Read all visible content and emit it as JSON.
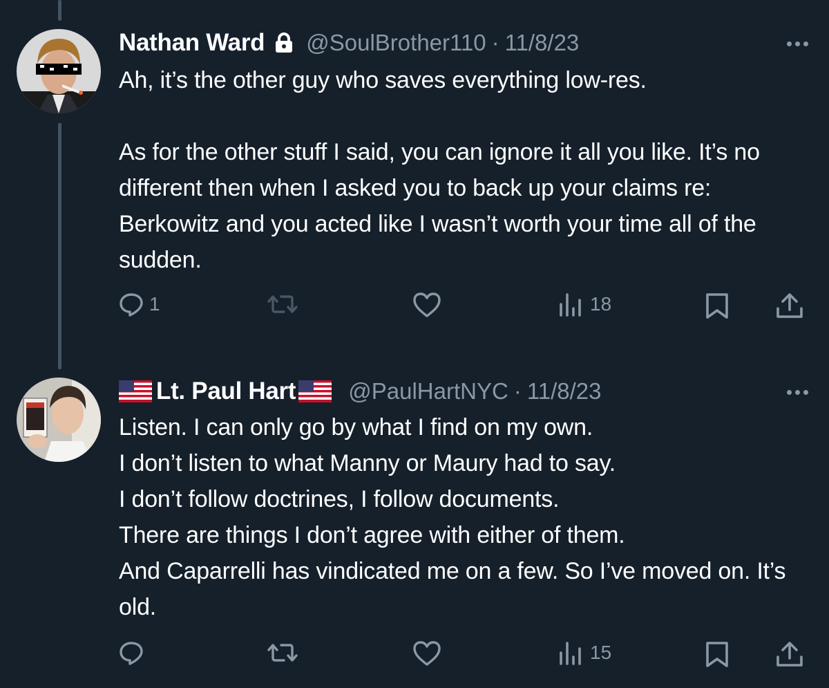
{
  "tweets": [
    {
      "name": "Nathan Ward",
      "handle": "@SoulBrother110",
      "separator": "·",
      "date": "11/8/23",
      "text": "Ah, it’s the other guy who saves everything low-res.\n\nAs for the other stuff I said, you can ignore it all you like. It’s no different then when I asked you to back up your claims re: Berkowitz and you acted like I wasn’t worth your time all of the sudden.",
      "reply_count": "1",
      "views": "18",
      "locked": true
    },
    {
      "name": "Lt. Paul Hart",
      "handle": "@PaulHartNYC",
      "separator": "·",
      "date": "11/8/23",
      "text": "Listen. I can only go by what I find on my own.\nI don’t listen to what Manny or Maury had to say.\nI don’t follow doctrines, I follow documents.\nThere are things I don’t agree with either of them.\nAnd Caparrelli has vindicated me on a few. So I’ve moved on. It’s old.",
      "reply_count": "",
      "views": "15",
      "flags": [
        "us-flag-icon",
        "us-flag-icon"
      ]
    }
  ],
  "icons": {
    "reply": "reply-icon",
    "retweet": "retweet-icon",
    "like": "like-icon",
    "views": "views-icon",
    "bookmark": "bookmark-icon",
    "share": "share-icon",
    "more": "more-icon",
    "lock": "lock-icon"
  },
  "colors": {
    "background": "#15202b",
    "text": "#ffffff",
    "muted": "#8b98a5",
    "thread_line": "#425364"
  }
}
